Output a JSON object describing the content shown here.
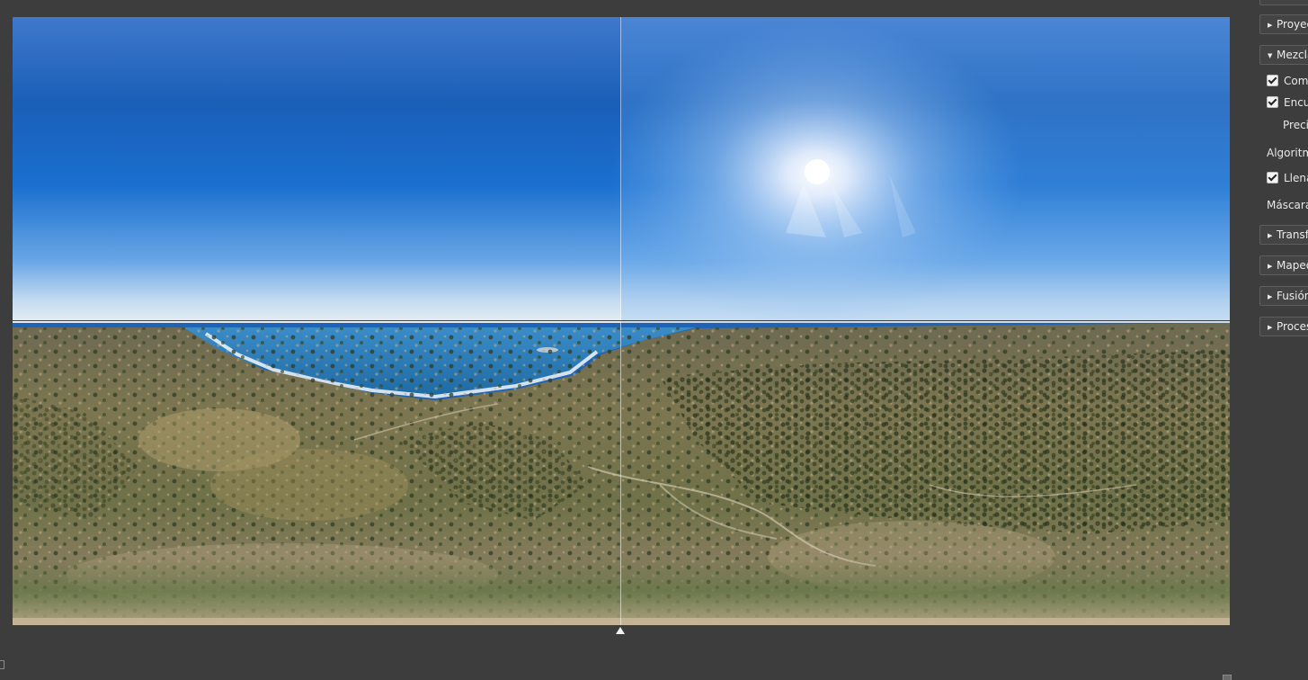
{
  "preview": {
    "image_description_icon": "equirectangular-panorama-image"
  },
  "panel": {
    "sections_top": [
      {
        "id": "proyeccion",
        "label": "Proyec",
        "expanded": false,
        "arrow": "▶"
      },
      {
        "id": "mezcla",
        "label": "Mezcla",
        "expanded": true,
        "arrow": "▼"
      }
    ],
    "mezcla_options": {
      "opt1": {
        "label": "Comp",
        "checked": true
      },
      "opt2": {
        "label": "Encu",
        "checked": true
      },
      "precision_label": "Precis",
      "algorithm_label": "Algoritm",
      "opt3": {
        "label": "Llena",
        "checked": true
      },
      "masks_label": "Máscaras"
    },
    "sections_bottom": [
      {
        "id": "transformar",
        "label": "Transfo",
        "arrow": "▶"
      },
      {
        "id": "mapeo",
        "label": "Mapeo",
        "arrow": "▶"
      },
      {
        "id": "fusion",
        "label": "Fusión",
        "arrow": "▶"
      },
      {
        "id": "procesado",
        "label": "Proces",
        "arrow": "▶"
      }
    ]
  },
  "colors": {
    "background": "#3d3d3d",
    "panel_header": "#444444",
    "sky_top": "#3f78cc",
    "sea": "#2a78b0"
  }
}
